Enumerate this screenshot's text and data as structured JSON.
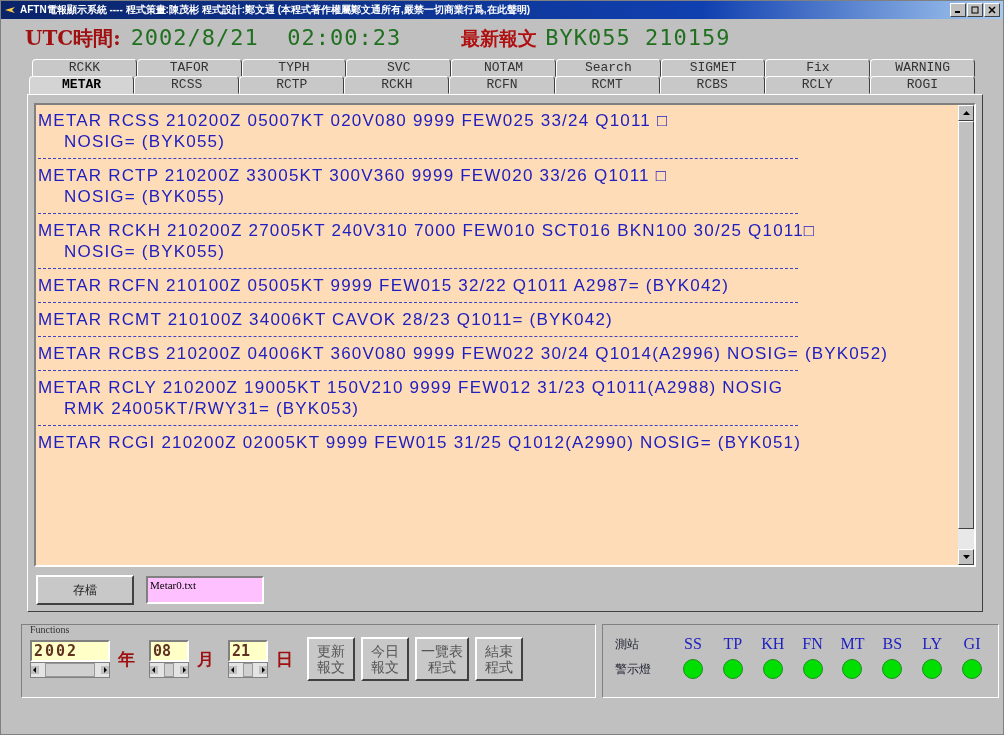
{
  "window": {
    "title": "AFTN電報顯示系統 ---- 程式策畫:陳茂彬 程式設計:鄭文通 (本程式著作權屬鄭文通所有,嚴禁一切商業行爲,在此聲明)"
  },
  "header": {
    "utc_label": "UTC時間:",
    "utc_value": "2002/8/21  02:00:23",
    "latest_label": "最新報文",
    "latest_value": "BYK055 210159"
  },
  "tab_rows": [
    {
      "tabs": [
        {
          "label": "RCKK",
          "selected": false
        },
        {
          "label": "TAFOR",
          "selected": false
        },
        {
          "label": "TYPH",
          "selected": false
        },
        {
          "label": "SVC",
          "selected": false
        },
        {
          "label": "NOTAM",
          "selected": false
        },
        {
          "label": "Search",
          "selected": false
        },
        {
          "label": "SIGMET",
          "selected": false
        },
        {
          "label": "Fix",
          "selected": false
        },
        {
          "label": "WARNING",
          "selected": false
        }
      ]
    },
    {
      "tabs": [
        {
          "label": "METAR",
          "selected": true
        },
        {
          "label": "RCSS",
          "selected": false
        },
        {
          "label": "RCTP",
          "selected": false
        },
        {
          "label": "RCKH",
          "selected": false
        },
        {
          "label": "RCFN",
          "selected": false
        },
        {
          "label": "RCMT",
          "selected": false
        },
        {
          "label": "RCBS",
          "selected": false
        },
        {
          "label": "RCLY",
          "selected": false
        },
        {
          "label": "ROGI",
          "selected": false
        }
      ]
    }
  ],
  "reports": [
    {
      "lines": [
        "METAR RCSS 210200Z 05007KT 020V080 9999 FEW025 33/24 Q1011 □",
        "NOSIG= (BYK055)"
      ]
    },
    {
      "lines": [
        "METAR RCTP 210200Z 33005KT 300V360 9999 FEW020 33/26 Q1011 □",
        "NOSIG= (BYK055)"
      ]
    },
    {
      "lines": [
        "METAR RCKH 210200Z 27005KT 240V310 7000 FEW010 SCT016 BKN100 30/25 Q1011□",
        "NOSIG= (BYK055)"
      ]
    },
    {
      "lines": [
        "METAR RCFN 210100Z 05005KT 9999 FEW015 32/22 Q1011 A2987= (BYK042)"
      ]
    },
    {
      "lines": [
        "METAR RCMT 210100Z 34006KT CAVOK 28/23 Q1011= (BYK042)"
      ]
    },
    {
      "lines": [
        "METAR RCBS 210200Z 04006KT 360V080 9999 FEW022 30/24 Q1014(A2996) NOSIG= (BYK052)"
      ]
    },
    {
      "lines": [
        "METAR RCLY 210200Z 19005KT 150V210 9999 FEW012 31/23 Q1011(A2988) NOSIG",
        "RMK 24005KT/RWY31= (BYK053)"
      ]
    },
    {
      "lines": [
        "METAR RCGI 210200Z 02005KT 9999 FEW015 31/25 Q1012(A2990) NOSIG= (BYK051)"
      ]
    }
  ],
  "save": {
    "button": "存檔",
    "file_value": "Metar0.txt"
  },
  "functions": {
    "title": "Functions",
    "year": "2002",
    "year_unit": "年",
    "month": "08",
    "month_unit": "月",
    "day": "21",
    "day_unit": "日",
    "buttons": [
      [
        "更新",
        "報文"
      ],
      [
        "今日",
        "報文"
      ],
      [
        "一覽表",
        "程式"
      ],
      [
        "結束",
        "程式"
      ]
    ]
  },
  "stations": {
    "row_label": "測站",
    "lamp_label": "警示燈",
    "items": [
      {
        "code": "SS",
        "color": "#00e000"
      },
      {
        "code": "TP",
        "color": "#00e000"
      },
      {
        "code": "KH",
        "color": "#00e000"
      },
      {
        "code": "FN",
        "color": "#00e000"
      },
      {
        "code": "MT",
        "color": "#00e000"
      },
      {
        "code": "BS",
        "color": "#00e000"
      },
      {
        "code": "LY",
        "color": "#00e000"
      },
      {
        "code": "GI",
        "color": "#00e000"
      }
    ]
  }
}
